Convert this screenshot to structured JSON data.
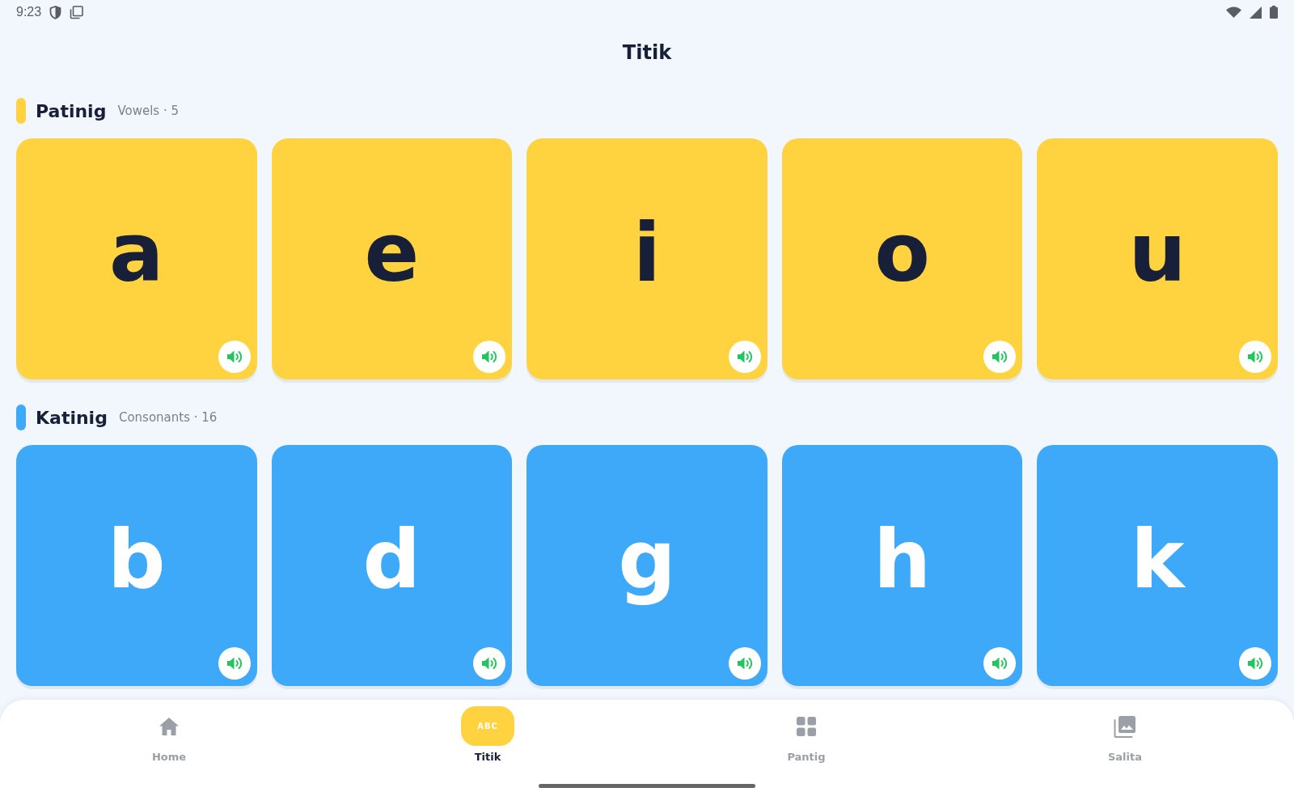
{
  "status_bar": {
    "time": "9:23"
  },
  "header": {
    "title": "Titik"
  },
  "sections": [
    {
      "kind": "vowels",
      "title": "Patinig",
      "subtitle": "Vowels · 5",
      "color": "#ffd33f",
      "letters": [
        "a",
        "e",
        "i",
        "o",
        "u"
      ]
    },
    {
      "kind": "consonants",
      "title": "Katinig",
      "subtitle": "Consonants · 16",
      "color": "#3fa9f9",
      "letters": [
        "b",
        "d",
        "g",
        "h",
        "k"
      ]
    }
  ],
  "nav": [
    {
      "kind": "home",
      "label": "Home",
      "selected": false
    },
    {
      "kind": "abc",
      "glyph": "ABC",
      "label": "Titik",
      "selected": true
    },
    {
      "kind": "grid",
      "label": "Pantig",
      "selected": false
    },
    {
      "kind": "gallery",
      "label": "Salita",
      "selected": false
    }
  ]
}
